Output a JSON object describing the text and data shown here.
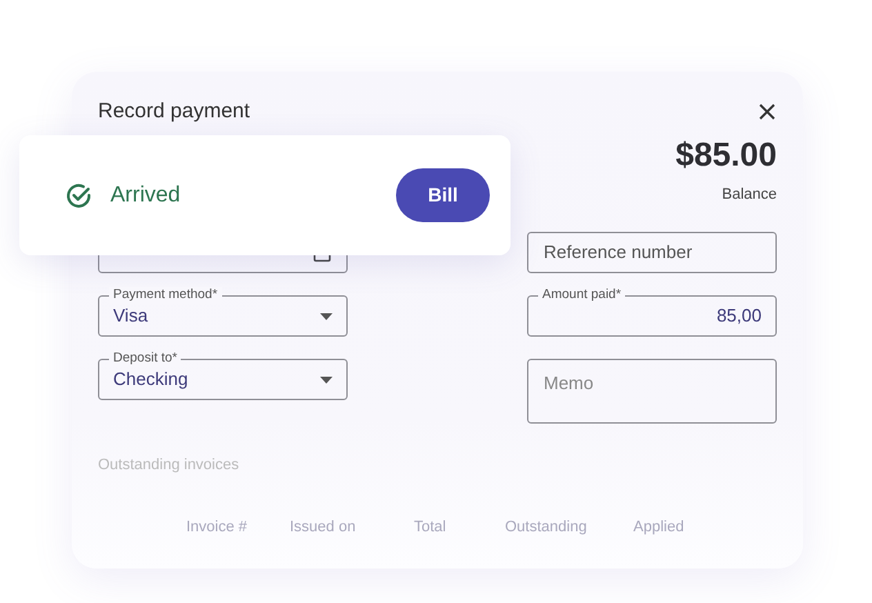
{
  "toast": {
    "status": "Arrived",
    "button": "Bill"
  },
  "dialog": {
    "title": "Record payment",
    "balance_amount": "$85.00",
    "balance_label": "Balance",
    "left_fields": [
      {
        "kind": "date"
      },
      {
        "kind": "select",
        "label": "Payment method*",
        "value": "Visa"
      },
      {
        "kind": "select",
        "label": "Deposit to*",
        "value": "Checking"
      }
    ],
    "right_fields": [
      {
        "kind": "text",
        "placeholder": "Reference number"
      },
      {
        "kind": "amount",
        "label": "Amount paid*",
        "value": "85,00"
      },
      {
        "kind": "textarea",
        "placeholder": "Memo"
      }
    ],
    "outstanding": {
      "title": "Outstanding invoices",
      "columns": [
        "Invoice #",
        "Issued on",
        "Total",
        "Outstanding",
        "Applied"
      ]
    }
  }
}
